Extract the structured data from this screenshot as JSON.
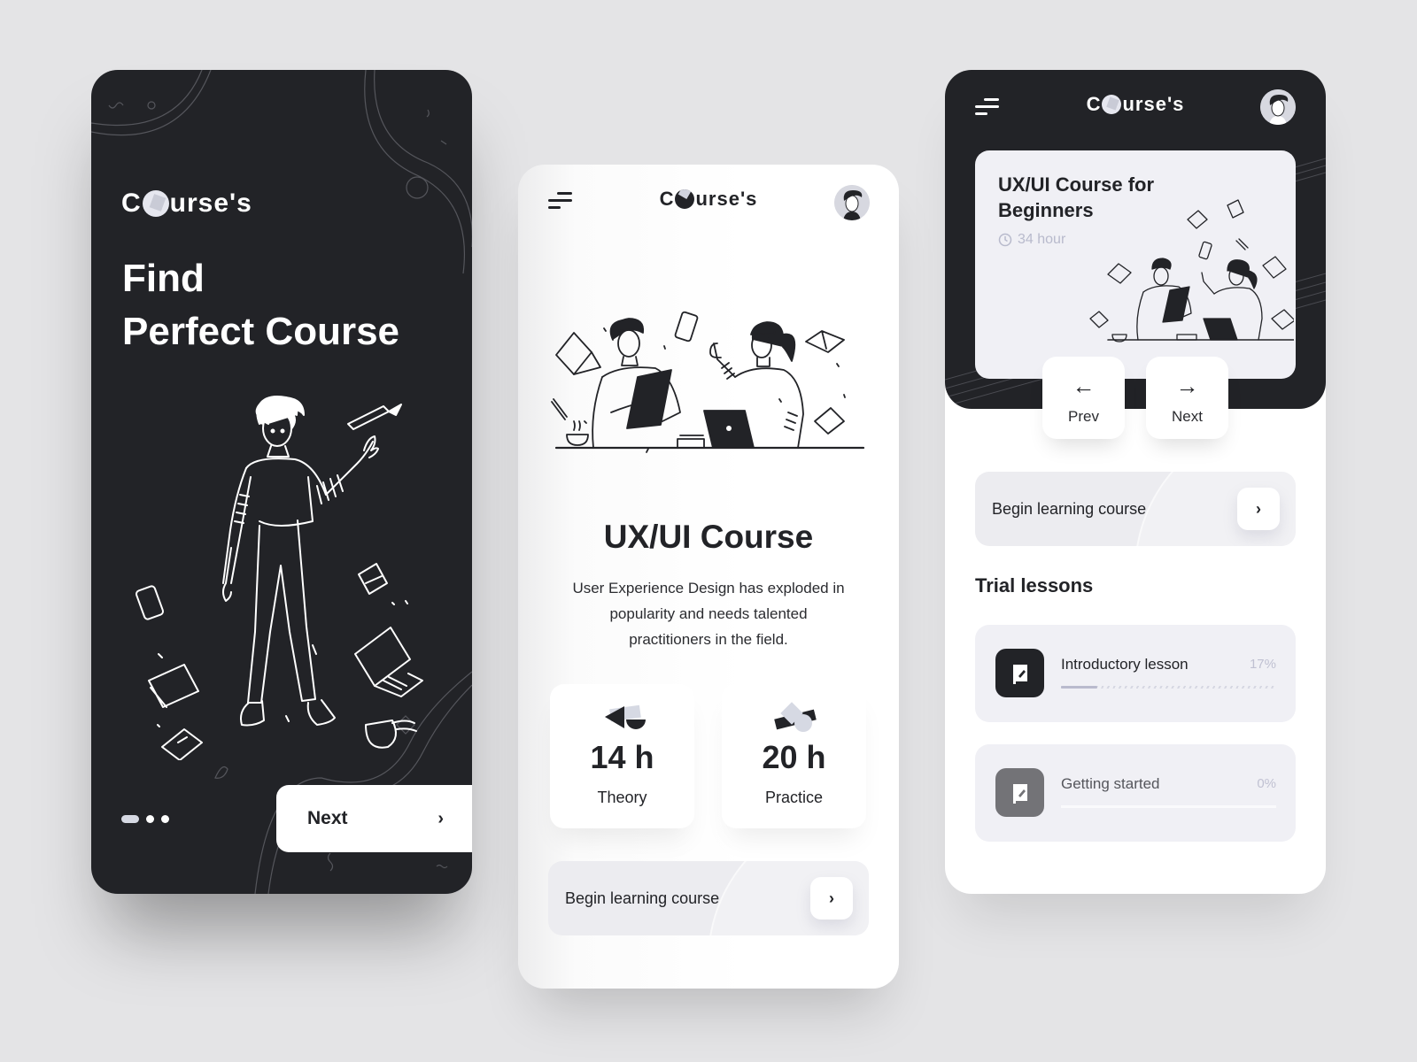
{
  "brand": {
    "name_prefix": "C",
    "name_suffix": "urse's"
  },
  "onboarding": {
    "title_line1": "Find",
    "title_line2": "Perfect Course",
    "pagination": {
      "total": 3,
      "active": 0
    },
    "next_label": "Next",
    "next_icon": "chevron-right-icon"
  },
  "course_detail": {
    "menu_icon": "menu-icon",
    "avatar_icon": "user-avatar",
    "title": "UX/UI Course",
    "description": "User Experience Design has exploded in popularity and needs talented practitioners in the field.",
    "stats": [
      {
        "value": "14 h",
        "label": "Theory",
        "icon": "shapes-icon"
      },
      {
        "value": "20 h",
        "label": "Practice",
        "icon": "shapes-icon"
      }
    ],
    "begin_label": "Begin learning course",
    "begin_icon": "chevron-right-icon"
  },
  "course_overview": {
    "featured": {
      "title": "UX/UI Course for Beginners",
      "duration": "34 hour",
      "duration_icon": "clock-icon"
    },
    "prev_label": "Prev",
    "next_label": "Next",
    "begin_label": "Begin learning course",
    "section_title": "Trial lessons",
    "lessons": [
      {
        "name": "Introductory lesson",
        "progress_text": "17%",
        "progress": 0.17,
        "icon": "notebook-icon"
      },
      {
        "name": "Getting started",
        "progress_text": "0%",
        "progress": 0,
        "icon": "notebook-icon"
      }
    ]
  },
  "colors": {
    "background": "#e4e4e6",
    "dark": "#222327",
    "light_card": "#f0f0f5",
    "muted": "#c0c1d2",
    "accent_soft": "#d6d9e3"
  }
}
